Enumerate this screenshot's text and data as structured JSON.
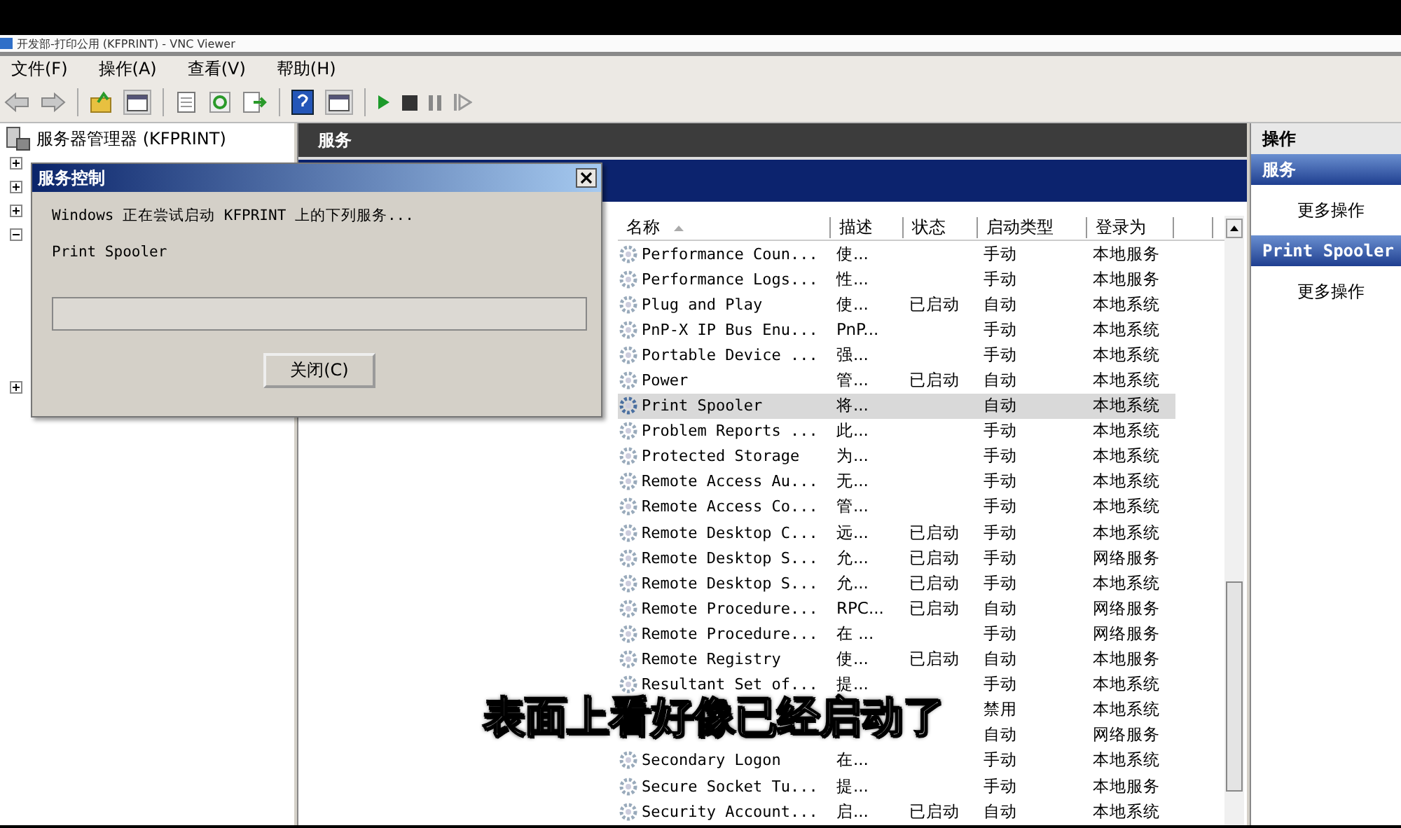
{
  "window": {
    "title": "开发部-打印公用 (KFPRINT) - VNC Viewer"
  },
  "menu": [
    "文件(F)",
    "操作(A)",
    "查看(V)",
    "帮助(H)"
  ],
  "tree": {
    "root": "服务器管理器 (KFPRINT)",
    "items": [
      {
        "expanded": false
      },
      {
        "expanded": false
      },
      {
        "expanded": false
      },
      {
        "expanded": true
      },
      {
        "expanded": false
      }
    ]
  },
  "services_panel": {
    "title": "服务",
    "columns": [
      "名称",
      "描述",
      "状态",
      "启动类型",
      "登录为"
    ],
    "rows": [
      {
        "name": "Performance Coun...",
        "description": "使...",
        "startup": "手动",
        "logon": "本地服务",
        "selected": false
      },
      {
        "name": "Performance Logs...",
        "description": "性...",
        "startup": "手动",
        "logon": "本地服务",
        "selected": false
      },
      {
        "name": "Plug and Play",
        "description": "使...",
        "status": "已启动",
        "startup": "自动",
        "logon": "本地系统",
        "selected": false
      },
      {
        "name": "PnP-X IP Bus Enu...",
        "description": "PnP...",
        "startup": "手动",
        "logon": "本地系统",
        "selected": false
      },
      {
        "name": "Portable Device ...",
        "description": "强...",
        "startup": "手动",
        "logon": "本地系统",
        "selected": false
      },
      {
        "name": "Power",
        "description": "管...",
        "status": "已启动",
        "startup": "自动",
        "logon": "本地系统",
        "selected": false
      },
      {
        "name": "Print Spooler",
        "description": "将...",
        "startup": "自动",
        "logon": "本地系统",
        "selected": true
      },
      {
        "name": "Problem Reports ...",
        "description": "此...",
        "startup": "手动",
        "logon": "本地系统",
        "selected": false
      },
      {
        "name": "Protected Storage",
        "description": "为...",
        "startup": "手动",
        "logon": "本地系统",
        "selected": false
      },
      {
        "name": "Remote Access Au...",
        "description": "无...",
        "startup": "手动",
        "logon": "本地系统",
        "selected": false
      },
      {
        "name": "Remote Access Co...",
        "description": "管...",
        "startup": "手动",
        "logon": "本地系统",
        "selected": false
      },
      {
        "name": "Remote Desktop C...",
        "description": "远...",
        "status": "已启动",
        "startup": "手动",
        "logon": "本地系统",
        "selected": false
      },
      {
        "name": "Remote Desktop S...",
        "description": "允...",
        "status": "已启动",
        "startup": "手动",
        "logon": "网络服务",
        "selected": false
      },
      {
        "name": "Remote Desktop S...",
        "description": "允...",
        "status": "已启动",
        "startup": "手动",
        "logon": "本地系统",
        "selected": false
      },
      {
        "name": "Remote Procedure...",
        "description": "RPC...",
        "status": "已启动",
        "startup": "自动",
        "logon": "网络服务",
        "selected": false
      },
      {
        "name": "Remote Procedure...",
        "description": "在 ...",
        "startup": "手动",
        "logon": "网络服务",
        "selected": false
      },
      {
        "name": "Remote Registry",
        "description": "使...",
        "status": "已启动",
        "startup": "自动",
        "logon": "本地服务",
        "selected": false
      },
      {
        "name": "Resultant Set of...",
        "description": "提...",
        "startup": "手动",
        "logon": "本地系统",
        "selected": false
      },
      {
        "startup": "禁用",
        "logon": "本地系统",
        "selected": false
      },
      {
        "startup": "自动",
        "logon": "网络服务",
        "selected": false
      },
      {
        "name": "Secondary Logon",
        "description": "在...",
        "startup": "手动",
        "logon": "本地系统",
        "selected": false
      },
      {
        "name": "Secure Socket Tu...",
        "description": "提...",
        "startup": "手动",
        "logon": "本地服务",
        "selected": false
      },
      {
        "name": "Security Account...",
        "description": "启...",
        "status": "已启动",
        "startup": "自动",
        "logon": "本地系统",
        "selected": false
      }
    ]
  },
  "actions": {
    "title": "操作",
    "sections": [
      {
        "title": "服务",
        "items": [
          "更多操作"
        ]
      },
      {
        "title": "Print Spooler",
        "items": [
          "更多操作"
        ]
      }
    ]
  },
  "dialog": {
    "title": "服务控制",
    "message": "Windows 正在尝试启动 KFPRINT 上的下列服务...",
    "service": "Print Spooler",
    "progress": {
      "level": 0
    },
    "button": "关闭(C)"
  },
  "subtitle": "表面上看好像已经启动了"
}
